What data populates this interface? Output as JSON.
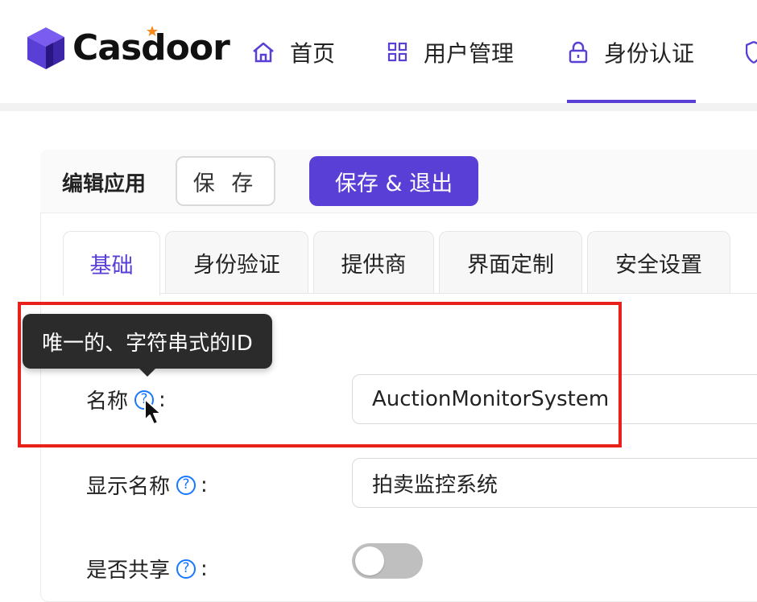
{
  "app": {
    "logo_text": "Casdoor"
  },
  "nav": {
    "items": [
      {
        "label": "首页",
        "icon": "home-icon"
      },
      {
        "label": "用户管理",
        "icon": "grid-icon"
      },
      {
        "label": "身份认证",
        "icon": "lock-icon",
        "active": true
      }
    ]
  },
  "edit": {
    "title": "编辑应用",
    "save_label": "保 存",
    "save_exit_label": "保存 & 退出"
  },
  "tabs": [
    {
      "label": "基础",
      "active": true
    },
    {
      "label": "身份验证"
    },
    {
      "label": "提供商"
    },
    {
      "label": "界面定制"
    },
    {
      "label": "安全设置"
    }
  ],
  "form": {
    "name": {
      "label": "名称",
      "help": "?",
      "value": "AuctionMonitorSystem"
    },
    "display_name": {
      "label": "显示名称",
      "help": "?",
      "value": "拍卖监控系统"
    },
    "is_shared": {
      "label": "是否共享",
      "help": "?",
      "value": false
    }
  },
  "tooltip": {
    "text": "唯一的、字符串式的ID"
  },
  "colon": ":",
  "colors": {
    "accent": "#5a3fd6",
    "highlight": "#e8221b",
    "help": "#1677ff"
  }
}
